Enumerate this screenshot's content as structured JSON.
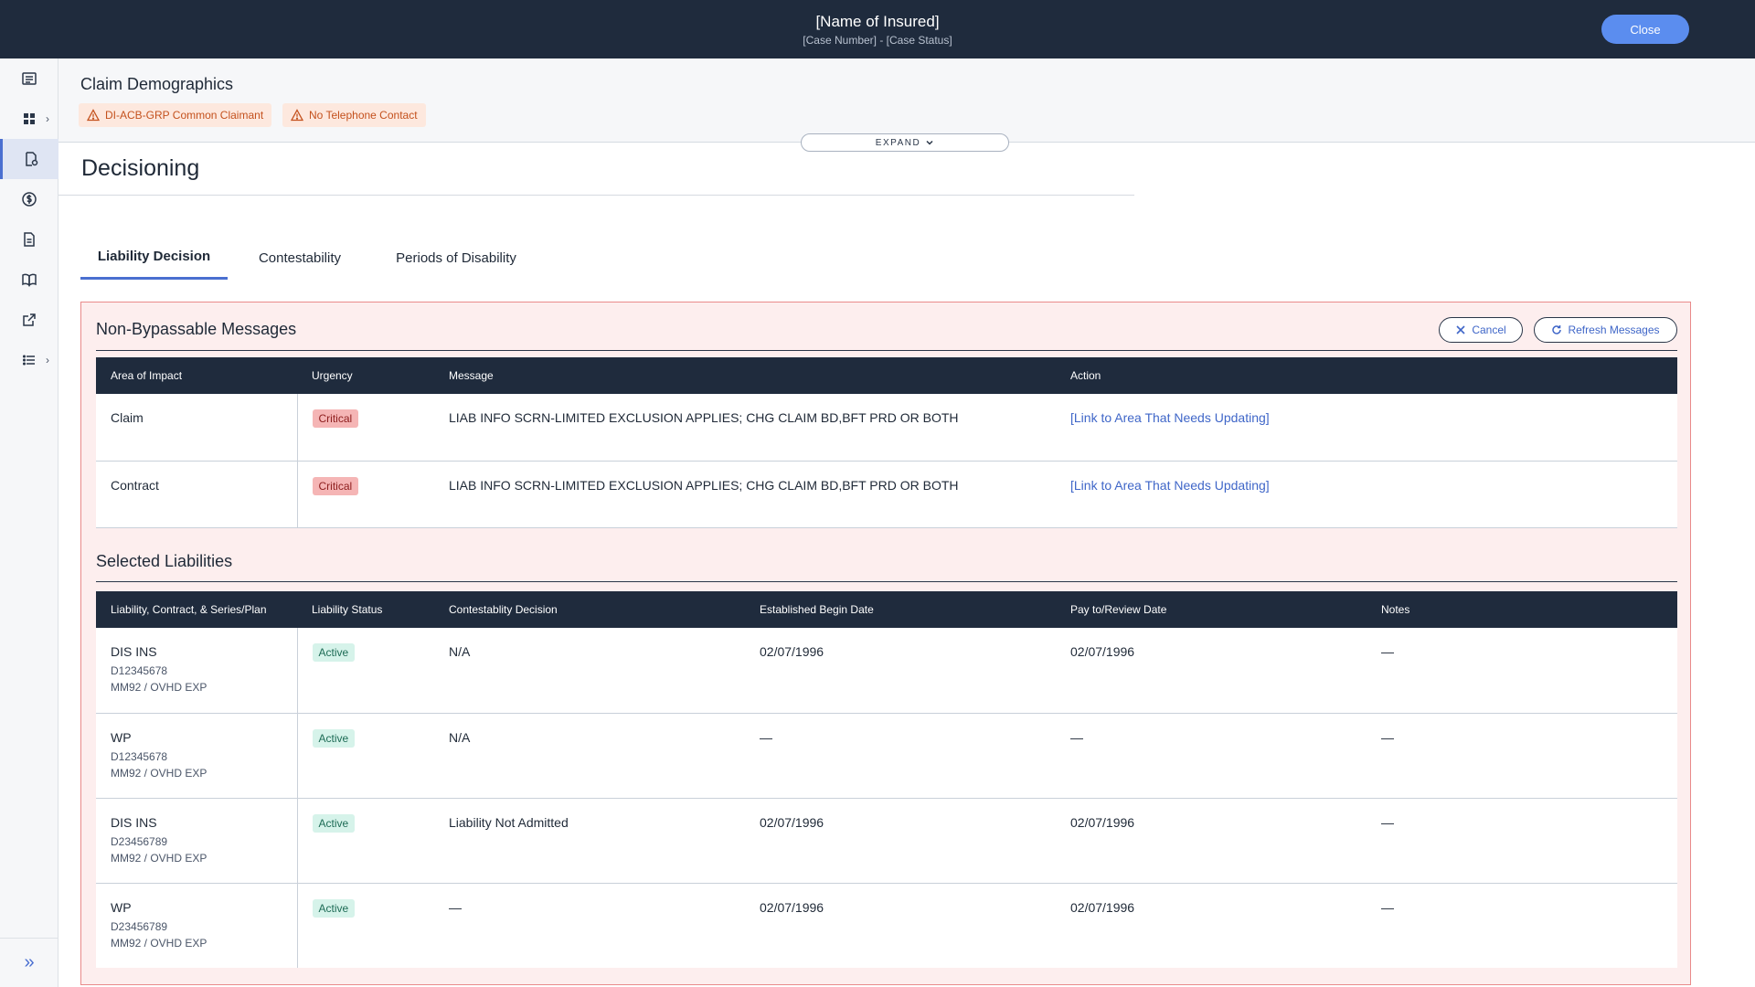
{
  "header": {
    "title": "[Name of Insured]",
    "subtitle": "[Case Number] - [Case Status]",
    "close_label": "Close"
  },
  "sidebar": {
    "items": [
      {
        "icon": "list-detail-icon",
        "has_chevron": false
      },
      {
        "icon": "dashboard-grid-icon",
        "has_chevron": true
      },
      {
        "icon": "document-settings-icon",
        "active": true
      },
      {
        "icon": "dollar-icon"
      },
      {
        "icon": "document-icon"
      },
      {
        "icon": "book-icon"
      },
      {
        "icon": "external-link-icon"
      },
      {
        "icon": "bullet-list-icon",
        "has_chevron": true
      }
    ],
    "collapse_icon": "double-chevron-right-icon"
  },
  "demographics": {
    "title": "Claim Demographics",
    "alerts": [
      "DI-ACB-GRP Common Claimant",
      "No Telephone Contact"
    ],
    "expand_label": "EXPAND"
  },
  "decisioning": {
    "title": "Decisioning",
    "tabs": [
      "Liability Decision",
      "Contestability",
      "Periods of Disability"
    ]
  },
  "messages": {
    "title": "Non-Bypassable Messages",
    "cancel_label": "Cancel",
    "refresh_label": "Refresh Messages",
    "columns": [
      "Area of Impact",
      "Urgency",
      "Message",
      "Action"
    ],
    "rows": [
      {
        "area": "Claim",
        "urgency": "Critical",
        "message": "LIAB INFO SCRN-LIMITED EXCLUSION APPLIES; CHG CLAIM BD,BFT PRD OR BOTH",
        "action": "[Link to Area That Needs Updating]"
      },
      {
        "area": "Contract",
        "urgency": "Critical",
        "message": "LIAB INFO SCRN-LIMITED EXCLUSION APPLIES; CHG CLAIM BD,BFT PRD OR BOTH",
        "action": "[Link to Area That Needs Updating]"
      }
    ]
  },
  "liabilities": {
    "title": "Selected Liabilities",
    "columns": [
      "Liability, Contract, & Series/Plan",
      "Liability Status",
      "Contestablity Decision",
      "Established Begin Date",
      "Pay to/Review Date",
      "Notes"
    ],
    "rows": [
      {
        "name": "DIS INS",
        "contract": "D12345678",
        "plan": "MM92 / OVHD EXP",
        "status": "Active",
        "decision": "N/A",
        "begin": "02/07/1996",
        "pay": "02/07/1996",
        "notes": "—"
      },
      {
        "name": "WP",
        "contract": "D12345678",
        "plan": "MM92 / OVHD EXP",
        "status": "Active",
        "decision": "N/A",
        "begin": "—",
        "pay": "—",
        "notes": "—"
      },
      {
        "name": "DIS INS",
        "contract": "D23456789",
        "plan": "MM92 / OVHD EXP",
        "status": "Active",
        "decision": "Liability Not Admitted",
        "begin": "02/07/1996",
        "pay": "02/07/1996",
        "notes": "—"
      },
      {
        "name": "WP",
        "contract": "D23456789",
        "plan": "MM92 / OVHD EXP",
        "status": "Active",
        "decision": "—",
        "begin": "02/07/1996",
        "pay": "02/07/1996",
        "notes": "—"
      }
    ]
  }
}
